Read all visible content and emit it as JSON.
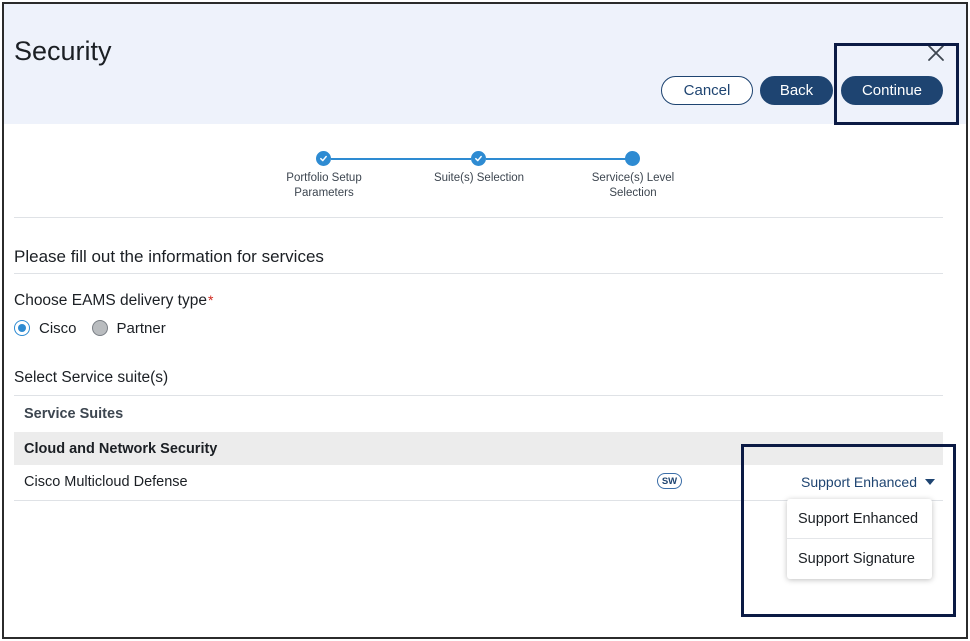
{
  "header": {
    "title": "Security",
    "close_icon": "close-icon"
  },
  "actions": {
    "cancel_label": "Cancel",
    "back_label": "Back",
    "continue_label": "Continue"
  },
  "stepper": {
    "steps": [
      {
        "line1": "Portfolio Setup",
        "line2": "Parameters",
        "state": "completed"
      },
      {
        "line1": "Suite(s) Selection",
        "line2": "",
        "state": "completed"
      },
      {
        "line1": "Service(s) Level",
        "line2": "Selection",
        "state": "active"
      }
    ]
  },
  "form": {
    "section_title": "Please fill out the information for services",
    "delivery_label": "Choose EAMS delivery type",
    "required_marker": "*",
    "delivery_options": [
      {
        "label": "Cisco",
        "selected": true
      },
      {
        "label": "Partner",
        "selected": false
      }
    ],
    "suite_label": "Select Service suite(s)"
  },
  "table": {
    "header": "Service Suites",
    "group": "Cloud and Network Security",
    "rows": [
      {
        "name": "Cisco Multicloud Defense",
        "badge": "SW",
        "selected_level": "Support Enhanced"
      }
    ]
  },
  "dropdown": {
    "options": [
      "Support Enhanced",
      "Support Signature"
    ]
  },
  "colors": {
    "header_bg": "#eef2fb",
    "primary": "#1e4471",
    "step_accent": "#2e8bd2",
    "group_row_bg": "#ececec",
    "required": "#d0271d",
    "highlight_box": "#0b1a44"
  }
}
